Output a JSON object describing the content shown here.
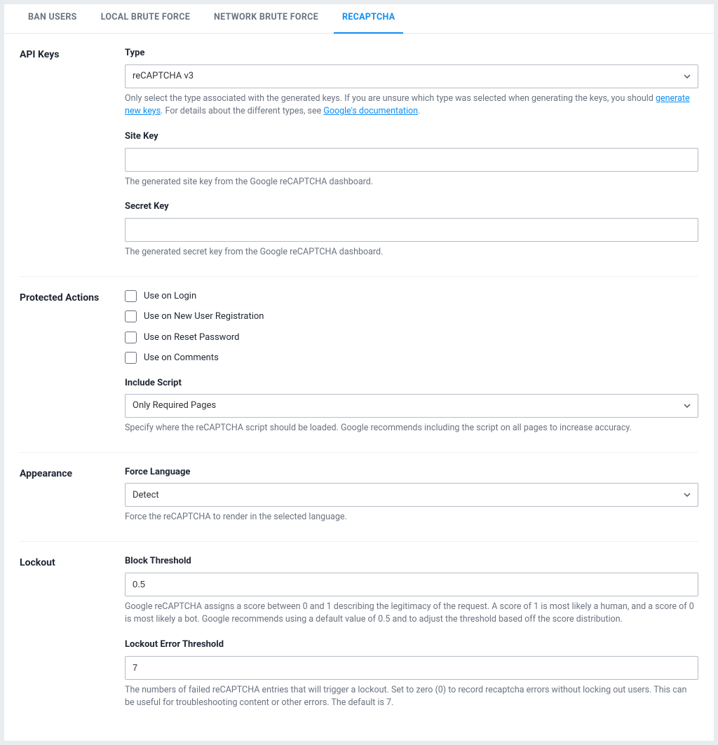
{
  "tabs": {
    "ban_users": "BAN USERS",
    "local_brute": "LOCAL BRUTE FORCE",
    "network_brute": "NETWORK BRUTE FORCE",
    "recaptcha": "RECAPTCHA"
  },
  "sections": {
    "api_keys": {
      "title": "API Keys",
      "type": {
        "label": "Type",
        "value": "reCAPTCHA v3",
        "help_prefix": "Only select the type associated with the generated keys. If you are unsure which type was selected when generating the keys, you should ",
        "help_link1": "generate new keys",
        "help_middle": ". For details about the different types, see ",
        "help_link2": "Google's documentation",
        "help_suffix": "."
      },
      "site_key": {
        "label": "Site Key",
        "value": "",
        "help": "The generated site key from the Google reCAPTCHA dashboard."
      },
      "secret_key": {
        "label": "Secret Key",
        "value": "",
        "help": "The generated secret key from the Google reCAPTCHA dashboard."
      }
    },
    "protected_actions": {
      "title": "Protected Actions",
      "use_login": "Use on Login",
      "use_register": "Use on New User Registration",
      "use_reset": "Use on Reset Password",
      "use_comments": "Use on Comments",
      "include_script": {
        "label": "Include Script",
        "value": "Only Required Pages",
        "help": "Specify where the reCAPTCHA script should be loaded. Google recommends including the script on all pages to increase accuracy."
      }
    },
    "appearance": {
      "title": "Appearance",
      "force_language": {
        "label": "Force Language",
        "value": "Detect",
        "help": "Force the reCAPTCHA to render in the selected language."
      }
    },
    "lockout": {
      "title": "Lockout",
      "block_threshold": {
        "label": "Block Threshold",
        "value": "0.5",
        "help": "Google reCAPTCHA assigns a score between 0 and 1 describing the legitimacy of the request. A score of 1 is most likely a human, and a score of 0 is most likely a bot. Google recommends using a default value of 0.5 and to adjust the threshold based off the score distribution."
      },
      "lockout_error": {
        "label": "Lockout Error Threshold",
        "value": "7",
        "help": "The numbers of failed reCAPTCHA entries that will trigger a lockout. Set to zero (0) to record recaptcha errors without locking out users. This can be useful for troubleshooting content or other errors. The default is 7."
      }
    }
  }
}
